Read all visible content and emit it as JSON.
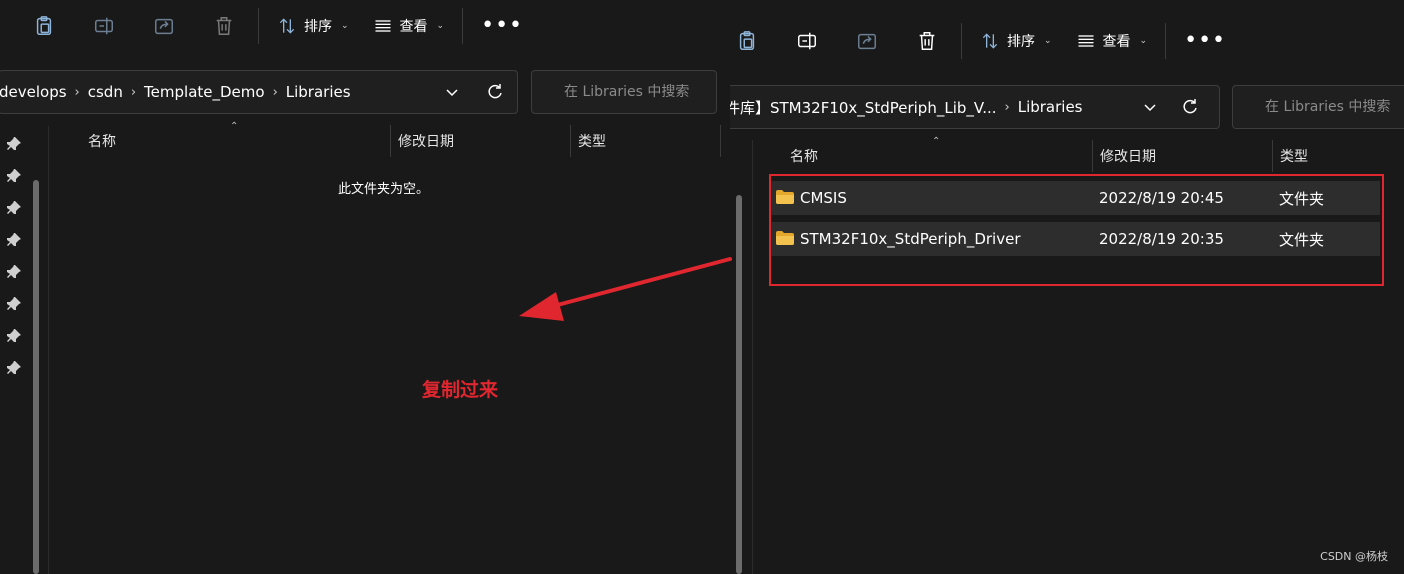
{
  "colors": {
    "background": "#191919",
    "selected_row": "#2d2d2d",
    "annotation_red": "#e0262f",
    "folder_yellow": "#f2c14e"
  },
  "left_window": {
    "toolbar": {
      "icons": [
        "paste-icon",
        "rename-icon",
        "share-icon",
        "delete-icon"
      ],
      "sort_label": "排序",
      "view_label": "查看",
      "more_label": "•••"
    },
    "breadcrumb": [
      "develops",
      "csdn",
      "Template_Demo",
      "Libraries"
    ],
    "search_placeholder": "在 Libraries 中搜索",
    "columns": {
      "name": "名称",
      "date": "修改日期",
      "type": "类型"
    },
    "empty_message": "此文件夹为空。"
  },
  "right_window": {
    "toolbar": {
      "icons": [
        "paste-icon",
        "rename-icon",
        "share-icon",
        "delete-icon"
      ],
      "sort_label": "排序",
      "view_label": "查看",
      "more_label": "•••"
    },
    "breadcrumb": [
      "件库】STM32F10x_StdPeriph_Lib_V...",
      "Libraries"
    ],
    "search_placeholder": "在 Libraries 中搜索",
    "columns": {
      "name": "名称",
      "date": "修改日期",
      "type": "类型"
    },
    "files": [
      {
        "name": "CMSIS",
        "date": "2022/8/19 20:45",
        "type": "文件夹"
      },
      {
        "name": "STM32F10x_StdPeriph_Driver",
        "date": "2022/8/19 20:35",
        "type": "文件夹"
      }
    ]
  },
  "annotation": {
    "callout_text": "复制过来"
  },
  "watermark": "CSDN @杨枝"
}
